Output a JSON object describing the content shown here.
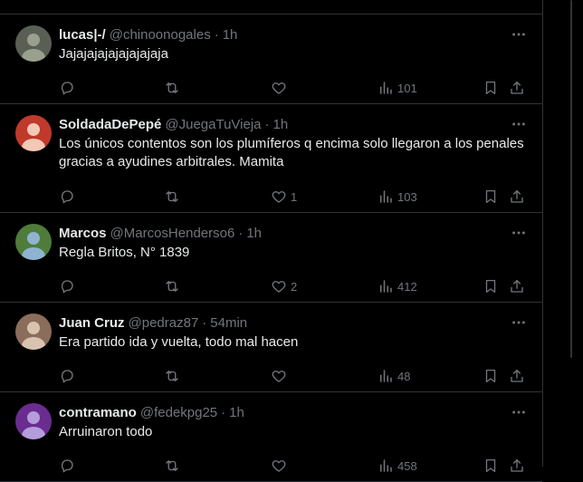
{
  "tweets": [
    {
      "name": "lucas|-/",
      "handle": "@chinoonogales",
      "time": "1h",
      "text": "Jajajajajajajajajaja",
      "replies": "",
      "retweets": "",
      "likes": "",
      "views": "101",
      "avatar_colors": [
        "#5a5f55",
        "#9aa08e"
      ]
    },
    {
      "name": "SoldadaDePepé",
      "handle": "@JuegaTuVieja",
      "time": "1h",
      "text": "Los únicos contentos son los plumíferos q encima solo llegaron a los penales gracias a ayudines arbitrales. Mamita",
      "replies": "",
      "retweets": "",
      "likes": "1",
      "views": "103",
      "avatar_colors": [
        "#c0392b",
        "#f1c9b5"
      ]
    },
    {
      "name": "Marcos",
      "handle": "@MarcosHenderso6",
      "time": "1h",
      "text": "Regla Britos, N° 1839",
      "replies": "",
      "retweets": "",
      "likes": "2",
      "views": "412",
      "avatar_colors": [
        "#4f7c3a",
        "#8fb3d1"
      ]
    },
    {
      "name": "Juan Cruz",
      "handle": "@pedraz87",
      "time": "54min",
      "text": "Era partido ida y vuelta, todo mal hacen",
      "replies": "",
      "retweets": "",
      "likes": "",
      "views": "48",
      "avatar_colors": [
        "#8a6d5a",
        "#d8c3b0"
      ]
    },
    {
      "name": "contramano",
      "handle": "@fedekpg25",
      "time": "1h",
      "text": "Arruinaron todo",
      "replies": "",
      "retweets": "",
      "likes": "",
      "views": "458",
      "avatar_colors": [
        "#6a2c8f",
        "#b39ddb"
      ]
    }
  ],
  "separator": "·",
  "colors": {
    "background": "#000000",
    "text": "#e7e9ea",
    "muted": "#71767b",
    "border": "#2f3336"
  },
  "icons": {
    "reply": "reply-icon",
    "retweet": "retweet-icon",
    "like": "heart-icon",
    "views": "views-icon",
    "bookmark": "bookmark-icon",
    "share": "share-icon",
    "more": "more-icon"
  }
}
